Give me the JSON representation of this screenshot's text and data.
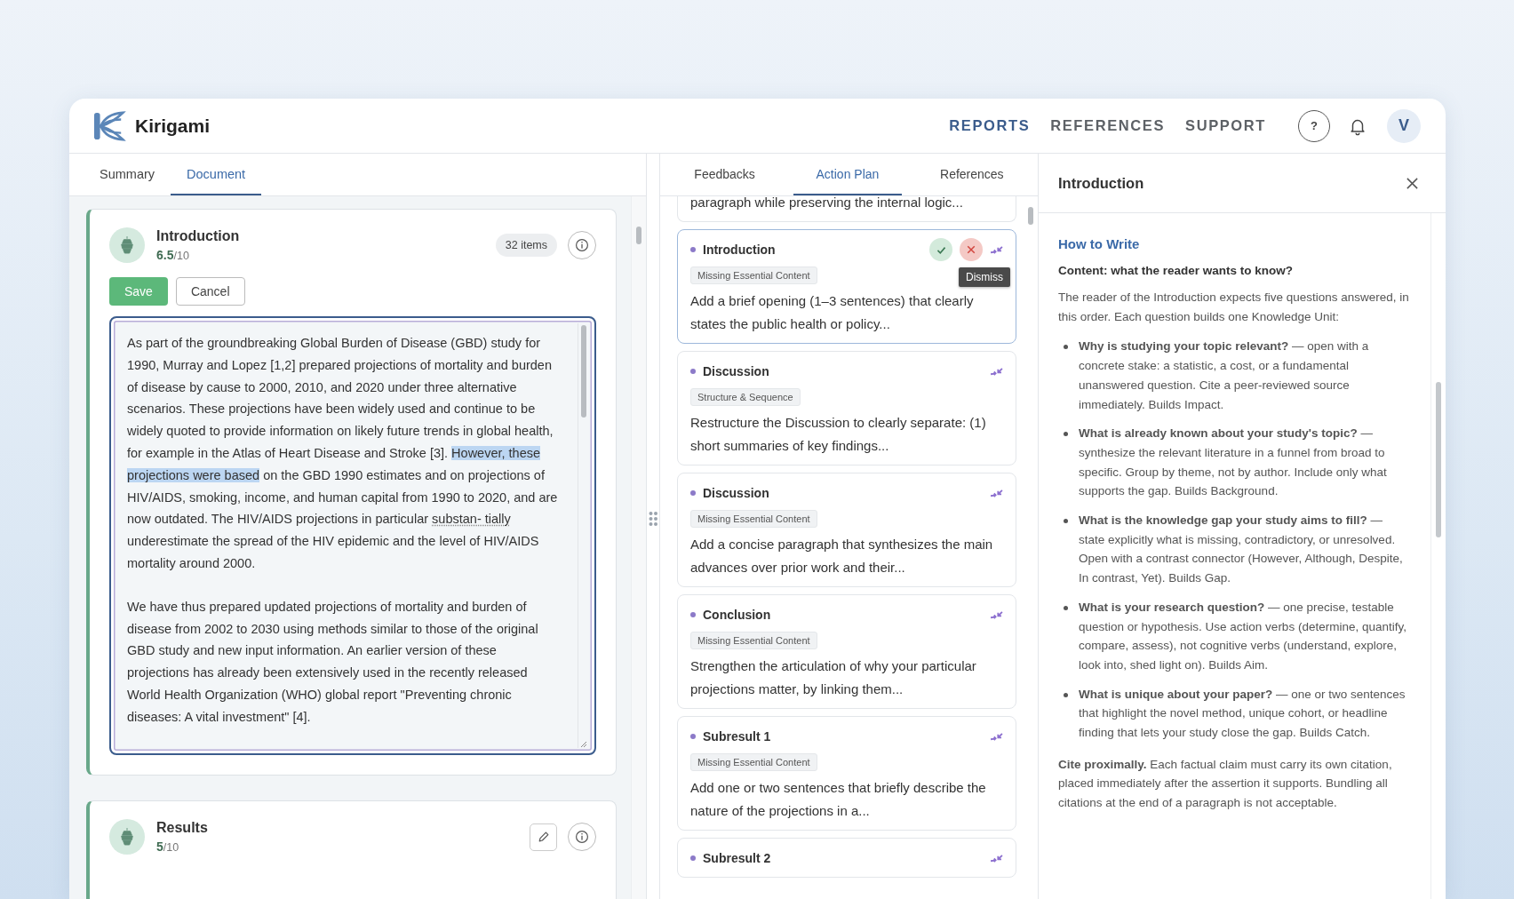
{
  "app": {
    "name": "Kirigami"
  },
  "nav": [
    {
      "label": "REPORTS",
      "selected": true
    },
    {
      "label": "REFERENCES",
      "selected": false
    },
    {
      "label": "SUPPORT",
      "selected": false
    }
  ],
  "header": {
    "help_label": "?",
    "avatar_initial": "V"
  },
  "document_panel": {
    "tabs": [
      {
        "label": "Summary",
        "selected": false
      },
      {
        "label": "Document",
        "selected": true
      }
    ],
    "sections": [
      {
        "title": "Introduction",
        "score": "6.5",
        "score_max": "/10",
        "editing": true,
        "items_count": "32 items",
        "save_label": "Save",
        "cancel_label": "Cancel",
        "paragraphs": [
          [
            {
              "kind": "plain",
              "text": "As part of the groundbreaking Global Burden of Disease (GBD) study for 1990, Murray and Lopez [1,2] prepared projections of mortality and burden of disease by cause to 2000, 2010, and 2020 under three alternative scenarios. These projections have been widely used and continue to be widely quoted to provide information on likely future trends in global health, for example in the Atlas of Heart Disease and Stroke [3]. "
            },
            {
              "kind": "highlight",
              "text": "However, these projections were based"
            },
            {
              "kind": "plain",
              "text": " on the GBD 1990 estimates and on projections of HIV/AIDS, smoking, income, and human capital from 1990 to 2020, and are now outdated. The HIV/AIDS projections in particular "
            },
            {
              "kind": "misspelled",
              "text": "substan- tially"
            },
            {
              "kind": "plain",
              "text": " underestimate the spread of the HIV epidemic and the level of HIV/AIDS mortality around 2000."
            }
          ],
          [
            {
              "kind": "plain",
              "text": "We have thus prepared updated projections of mortality and burden of disease from 2002 to 2030 using methods similar to those of the original GBD study and new input information. An earlier version of these projections has already been extensively used in the recently released World Health Organization (WHO) global report \"Preventing chronic diseases: A vital investment\" [4]."
            }
          ]
        ]
      },
      {
        "title": "Results",
        "score": "5",
        "score_max": "/10",
        "editing": false
      }
    ]
  },
  "action_panel": {
    "tabs": [
      {
        "label": "Feedbacks",
        "selected": false
      },
      {
        "label": "Action Plan",
        "selected": true
      },
      {
        "label": "References",
        "selected": false
      }
    ],
    "items": [
      {
        "kind": "partial",
        "text": "paragraph while preserving the internal logic...",
        "selected": false
      },
      {
        "kind": "full",
        "section": "Introduction",
        "tag": "Missing Essential Content",
        "text": "Add a brief opening (1–3 sentences) that clearly states the public health or policy...",
        "selected": true,
        "tooltip": "Dismiss"
      },
      {
        "kind": "full",
        "section": "Discussion",
        "tag": "Structure & Sequence",
        "text": "Restructure the Discussion to clearly separate: (1) short summaries of key findings...",
        "selected": false
      },
      {
        "kind": "full",
        "section": "Discussion",
        "tag": "Missing Essential Content",
        "text": "Add a concise paragraph that synthesizes the main advances over prior work and their...",
        "selected": false
      },
      {
        "kind": "full",
        "section": "Conclusion",
        "tag": "Missing Essential Content",
        "text": "Strengthen the articulation of why your particular projections matter, by linking them...",
        "selected": false
      },
      {
        "kind": "full",
        "section": "Subresult 1",
        "tag": "Missing Essential Content",
        "text": "Add one or two sentences that briefly describe the nature of the projections in a...",
        "selected": false
      },
      {
        "kind": "full",
        "section": "Subresult 2",
        "selected": false
      }
    ]
  },
  "guide_panel": {
    "title": "Introduction",
    "heading": "How to Write",
    "subheading": "Content: what the reader wants to know?",
    "intro": "The reader of the Introduction expects five questions answered, in this order. Each question builds one Knowledge Unit:",
    "bullets": [
      "**Why is studying your topic relevant?** — open with a concrete stake: a statistic, a cost, or a fundamental unanswered question. Cite a peer-reviewed source immediately. Builds Impact.",
      "**What is already known about your study's topic?** — synthesize the relevant literature in a funnel from broad to specific. Group by theme, not by author. Include only what supports the gap. Builds Background.",
      "**What is the knowledge gap your study aims to fill?** — state explicitly what is missing, contradictory, or unresolved. Open with a contrast connector (However, Although, Despite, In contrast, Yet). Builds Gap.",
      "**What is your research question?** — one precise, testable question or hypothesis. Use action verbs (determine, quantify, compare, assess), not cognitive verbs (understand, explore, look into, shed light on). Builds Aim.",
      "**What is unique about your paper?** — one or two sentences that highlight the novel method, unique cohort, or headline finding that lets your study close the gap. Builds Catch."
    ],
    "closing": "**Cite proximally.** Each factual claim must carry its own citation, placed immediately after the assertion it supports. Bundling all citations at the end of a paragraph is not acceptable."
  }
}
